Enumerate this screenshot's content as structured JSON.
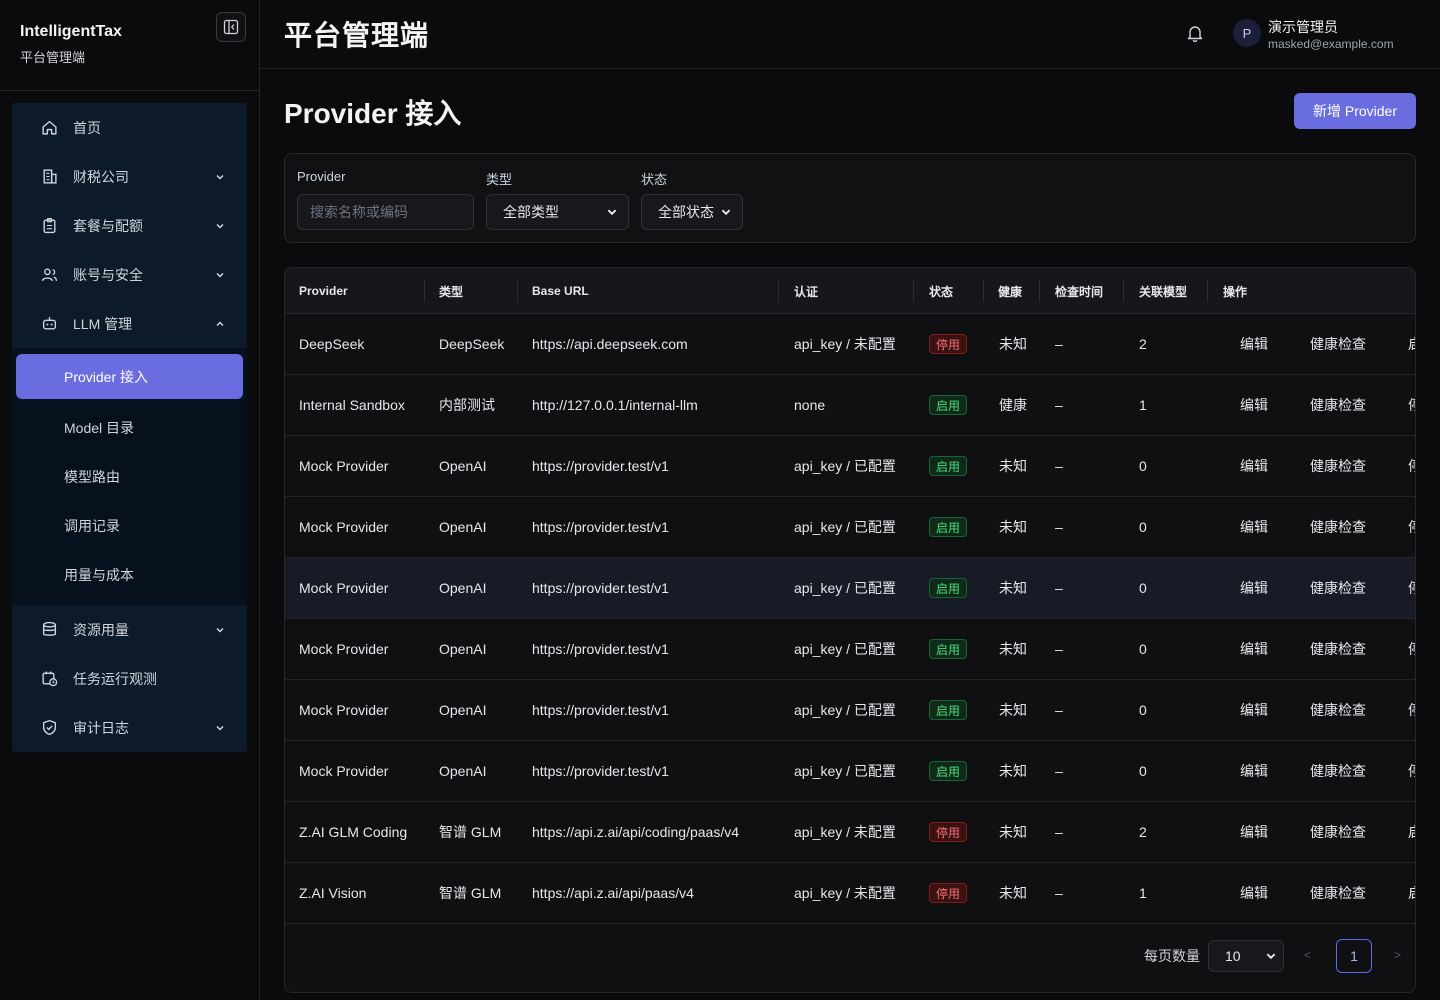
{
  "brand": {
    "name": "IntelligentTax",
    "subtitle": "平台管理端"
  },
  "header": {
    "title": "平台管理端",
    "user_name": "演示管理员",
    "user_email": "masked@example.com",
    "avatar_initial": "P"
  },
  "sidebar": {
    "items": [
      {
        "label": "首页"
      },
      {
        "label": "财税公司"
      },
      {
        "label": "套餐与配额"
      },
      {
        "label": "账号与安全"
      },
      {
        "label": "LLM 管理"
      }
    ],
    "sub_items": [
      {
        "label": "Provider 接入"
      },
      {
        "label": "Model 目录"
      },
      {
        "label": "模型路由"
      },
      {
        "label": "调用记录"
      },
      {
        "label": "用量与成本"
      }
    ],
    "after_items": [
      {
        "label": "资源用量"
      },
      {
        "label": "任务运行观测"
      },
      {
        "label": "审计日志"
      }
    ]
  },
  "page": {
    "title": "Provider 接入",
    "add_button": "新增 Provider"
  },
  "filters": {
    "provider_label": "Provider",
    "provider_placeholder": "搜索名称或编码",
    "type_label": "类型",
    "type_value": "全部类型",
    "status_label": "状态",
    "status_value": "全部状态"
  },
  "table": {
    "headers": [
      "Provider",
      "类型",
      "Base URL",
      "认证",
      "状态",
      "健康",
      "检查时间",
      "关联模型",
      "操作"
    ],
    "rows": [
      {
        "provider": "DeepSeek",
        "type": "DeepSeek",
        "base_url": "https://api.deepseek.com",
        "auth": "api_key / 未配置",
        "status": "停用",
        "health": "未知",
        "checked": "–",
        "models": "2",
        "edit": "编辑",
        "check": "健康检查",
        "toggle": "启"
      },
      {
        "provider": "Internal Sandbox",
        "type": "内部测试",
        "base_url": "http://127.0.0.1/internal-llm",
        "auth": "none",
        "status": "启用",
        "health": "健康",
        "checked": "–",
        "models": "1",
        "edit": "编辑",
        "check": "健康检查",
        "toggle": "停"
      },
      {
        "provider": "Mock Provider",
        "type": "OpenAI",
        "base_url": "https://provider.test/v1",
        "auth": "api_key / 已配置",
        "status": "启用",
        "health": "未知",
        "checked": "–",
        "models": "0",
        "edit": "编辑",
        "check": "健康检查",
        "toggle": "停"
      },
      {
        "provider": "Mock Provider",
        "type": "OpenAI",
        "base_url": "https://provider.test/v1",
        "auth": "api_key / 已配置",
        "status": "启用",
        "health": "未知",
        "checked": "–",
        "models": "0",
        "edit": "编辑",
        "check": "健康检查",
        "toggle": "停"
      },
      {
        "provider": "Mock Provider",
        "type": "OpenAI",
        "base_url": "https://provider.test/v1",
        "auth": "api_key / 已配置",
        "status": "启用",
        "health": "未知",
        "checked": "–",
        "models": "0",
        "edit": "编辑",
        "check": "健康检查",
        "toggle": "停"
      },
      {
        "provider": "Mock Provider",
        "type": "OpenAI",
        "base_url": "https://provider.test/v1",
        "auth": "api_key / 已配置",
        "status": "启用",
        "health": "未知",
        "checked": "–",
        "models": "0",
        "edit": "编辑",
        "check": "健康检查",
        "toggle": "停"
      },
      {
        "provider": "Mock Provider",
        "type": "OpenAI",
        "base_url": "https://provider.test/v1",
        "auth": "api_key / 已配置",
        "status": "启用",
        "health": "未知",
        "checked": "–",
        "models": "0",
        "edit": "编辑",
        "check": "健康检查",
        "toggle": "停"
      },
      {
        "provider": "Mock Provider",
        "type": "OpenAI",
        "base_url": "https://provider.test/v1",
        "auth": "api_key / 已配置",
        "status": "启用",
        "health": "未知",
        "checked": "–",
        "models": "0",
        "edit": "编辑",
        "check": "健康检查",
        "toggle": "停"
      },
      {
        "provider": "Z.AI GLM Coding",
        "type": "智谱 GLM",
        "base_url": "https://api.z.ai/api/coding/paas/v4",
        "auth": "api_key / 未配置",
        "status": "停用",
        "health": "未知",
        "checked": "–",
        "models": "2",
        "edit": "编辑",
        "check": "健康检查",
        "toggle": "启"
      },
      {
        "provider": "Z.AI Vision",
        "type": "智谱 GLM",
        "base_url": "https://api.z.ai/api/paas/v4",
        "auth": "api_key / 未配置",
        "status": "停用",
        "health": "未知",
        "checked": "–",
        "models": "1",
        "edit": "编辑",
        "check": "健康检查",
        "toggle": "启"
      }
    ]
  },
  "pagination": {
    "page_size_label": "每页数量",
    "page_size": "10",
    "prev": "<",
    "current_page": "1",
    "next": ">"
  },
  "colors": {
    "accent": "#6a6de0",
    "enabled": "#4ade80",
    "disabled": "#f87171"
  }
}
